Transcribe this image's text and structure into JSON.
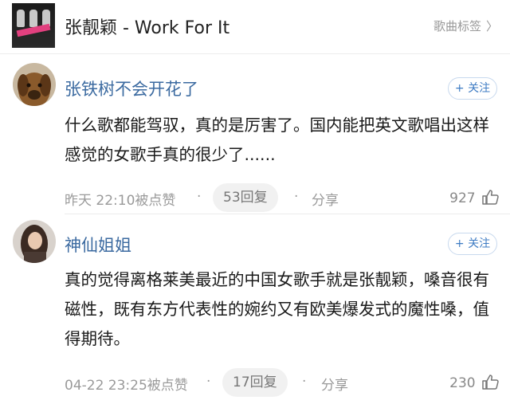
{
  "header": {
    "title": "张靓颖 - Work For It",
    "tags_label": "歌曲标签",
    "tags_chevron": "〉"
  },
  "comments": [
    {
      "username": "张铁树不会开花了",
      "follow_label": "+ 关注",
      "text": "什么歌都能驾驭，真的是厉害了。国内能把英文歌唱出这样感觉的女歌手真的很少了......",
      "time": "昨天 22:10被点赞",
      "replies": "53回复",
      "share": "分享",
      "likes": "927"
    },
    {
      "username": "神仙姐姐",
      "follow_label": "+ 关注",
      "text": "真的觉得离格莱美最近的中国女歌手就是张靓颖，嗓音很有磁性，既有东方代表性的婉约又有欧美爆发式的魔性嗓，值得期待。",
      "time": "04-22 23:25被点赞",
      "replies": "17回复",
      "share": "分享",
      "likes": "230"
    }
  ],
  "colors": {
    "username": "#3b6aa0",
    "follow_button": "#3d7bc3",
    "meta_text": "#9a9a9a"
  }
}
